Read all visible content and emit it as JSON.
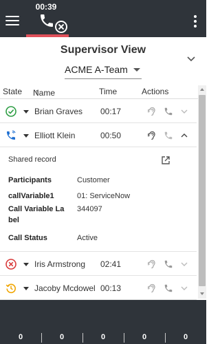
{
  "topbar": {
    "timer": "00:39",
    "accent": "#e0505a",
    "background": "#2f343a"
  },
  "header": {
    "title": "Supervisor View",
    "team": "ACME A-Team"
  },
  "table": {
    "columns": {
      "state": "State",
      "name": "Name",
      "time": "Time",
      "actions": "Actions"
    },
    "sort_indicator": "↑"
  },
  "rows": [
    {
      "name": "Brian Graves",
      "time": "00:17",
      "status_icon": "check-circle-icon",
      "status_color": "#2e9e44"
    },
    {
      "name": "Elliott Klein",
      "time": "00:50",
      "status_icon": "phone-incoming-icon",
      "status_color": "#1f6fd1"
    },
    {
      "name": "Iris Armstrong",
      "time": "02:41",
      "status_icon": "x-circle-icon",
      "status_color": "#d93a3a"
    },
    {
      "name": "Jacoby Mcdowel",
      "time": "00:13",
      "status_icon": "history-icon",
      "status_color": "#f0a500"
    }
  ],
  "detail": {
    "shared_label": "Shared record",
    "fields": [
      {
        "key": "Participants",
        "value": "Customer"
      },
      {
        "key": "callVariable1",
        "value": "01: ServiceNow"
      },
      {
        "key": "Call Variable La bel",
        "value": "344097"
      },
      {
        "key": "Call Status",
        "value": "Active"
      }
    ]
  },
  "footer": {
    "stats": [
      "0",
      "0",
      "0",
      "0",
      "0"
    ]
  }
}
